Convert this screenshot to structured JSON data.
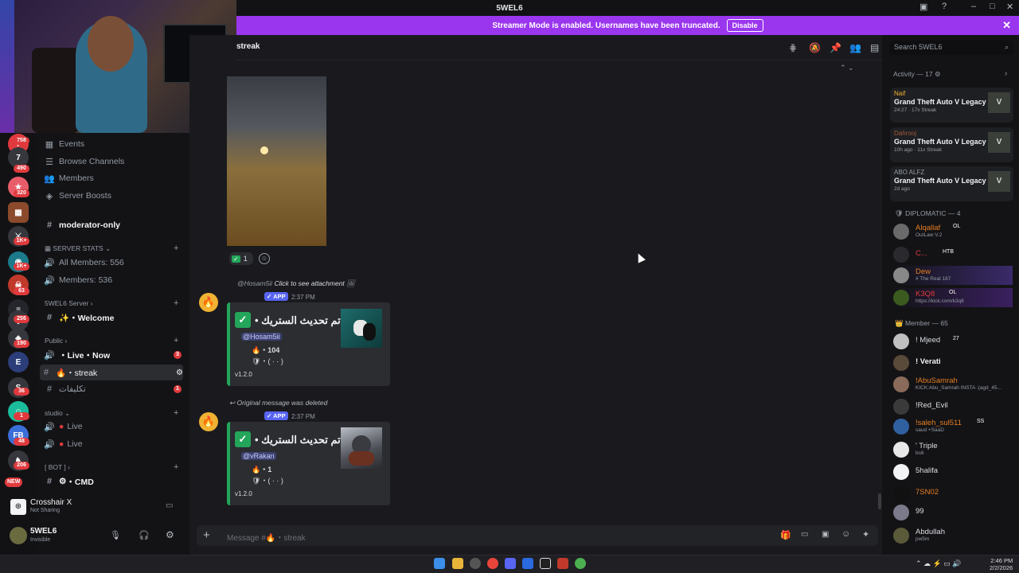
{
  "window": {
    "title": "5WEL6"
  },
  "banner": {
    "text": "Streamer Mode is enabled. Usernames have been truncated.",
    "button": "Disable"
  },
  "rail": {
    "badges": [
      {
        "label": "758"
      },
      {
        "label": "490"
      },
      {
        "label": "320"
      },
      {
        "label": "1K+"
      },
      {
        "label": "1K+"
      },
      {
        "label": "63"
      },
      {
        "label": "256"
      },
      {
        "label": "190"
      },
      {
        "label": "36"
      },
      {
        "label": "1"
      },
      {
        "label": "48"
      },
      {
        "label": "206"
      }
    ],
    "new_label": "NEW"
  },
  "sidebar": {
    "top_items": [
      {
        "label": "Events",
        "icon": "calendar-icon"
      },
      {
        "label": "Browse Channels",
        "icon": "browse-icon"
      },
      {
        "label": "Members",
        "icon": "members-icon"
      },
      {
        "label": "Server Boosts",
        "icon": "boost-icon"
      }
    ],
    "moderator": "moderator-only",
    "cat_stats": "SERVER STATS",
    "stat1": "All Members: 556",
    "stat2": "Members: 536",
    "cat_server": "5WEL6 Server",
    "welcome": "・Welcome",
    "cat_public": "Public",
    "live_now": "・Live・Now",
    "live_now_badge": "3",
    "streak": "・streak",
    "takleefat": "تكليفات",
    "takleefat_badge": "1",
    "cat_studio": "studio",
    "live1": "Live",
    "live2": "Live",
    "cat_bot": "[ BOT ]",
    "cmd": "・CMD"
  },
  "crosshair": {
    "name": "Crosshair X",
    "status": "Not Sharing"
  },
  "user": {
    "name": "5WEL6",
    "status": "Invisible"
  },
  "header": {
    "channel": "streak"
  },
  "message1": {
    "reaction_count": "1"
  },
  "message2": {
    "reply": "@Hosam5ii",
    "reply_action": "Click to see attachment",
    "app": "✓ APP",
    "time": "2:37 PM",
    "title": "تم تحديث الستريك •",
    "mention": "@Hosam5ii",
    "count": "・104",
    "sub": "・(   ·   ·   )",
    "version": "v1.2.0"
  },
  "message3": {
    "reply": "Original message was deleted",
    "app": "✓ APP",
    "time": "2:37 PM",
    "title": "تم تحديث الستريك •",
    "mention": "@vRakan",
    "count": "・1",
    "sub": "・(   ·   ·   )",
    "version": "v1.2.0"
  },
  "composer": {
    "placeholder": "Message #🔥・streak"
  },
  "search": {
    "placeholder": "Search 5WEL6"
  },
  "activity": {
    "header": "Activity — 17",
    "items": [
      {
        "name": "Naif",
        "game": "Grand Theft Auto V Legacy",
        "status": "24:27 · 17x Streak",
        "name_color": "#f0b232"
      },
      {
        "name": "Dahrooj",
        "game": "Grand Theft Auto V Legacy",
        "status": "10h ago · 11x Streak",
        "name_color": "#a05a3a"
      },
      {
        "name": "ABO ALFZ",
        "game": "Grand Theft Auto V Legacy",
        "status": "2d ago",
        "name_color": "#949ba4"
      }
    ],
    "gta_label": "V"
  },
  "groups": {
    "diplomatic": "DIPLOMATIC — 4",
    "member": "Member — 65"
  },
  "diplomatic": [
    {
      "name": "Alqallaf",
      "tag": "OL",
      "sub": "OutLaw V.2",
      "color": "#e67e22"
    },
    {
      "name": "C...",
      "tag": "HTB",
      "sub": "",
      "color": "#e03a3e"
    },
    {
      "name": "Dew",
      "tag": "",
      "sub": "# The Real 187",
      "color": "#e67e22"
    },
    {
      "name": "K3Q8",
      "tag": "OL",
      "sub": "https://kick.com/k3q8",
      "color": "#e03a3e"
    }
  ],
  "members": [
    {
      "name": "! Mjeed",
      "tag": "27",
      "sub": ""
    },
    {
      "name": "! Verati",
      "tag": "",
      "sub": ""
    },
    {
      "name": "!AbuSamrah",
      "tag": "",
      "sub": "KICK:Abu_Samrah INSTA :(agd_45..."
    },
    {
      "name": "!Red_Evil",
      "tag": "",
      "sub": ""
    },
    {
      "name": "!saleh_sul511",
      "tag": "SS",
      "sub": "saud +SaaD"
    },
    {
      "name": "' Triple",
      "tag": "",
      "sub": "bs6"
    },
    {
      "name": "5halifa",
      "tag": "",
      "sub": ""
    },
    {
      "name": "7SN02",
      "tag": "",
      "sub": ""
    },
    {
      "name": "99",
      "tag": "",
      "sub": ""
    },
    {
      "name": "Abdullah",
      "tag": "",
      "sub": "pw5m"
    }
  ],
  "taskbar": {
    "time": "2:46 PM",
    "date": "2/2/2026"
  }
}
